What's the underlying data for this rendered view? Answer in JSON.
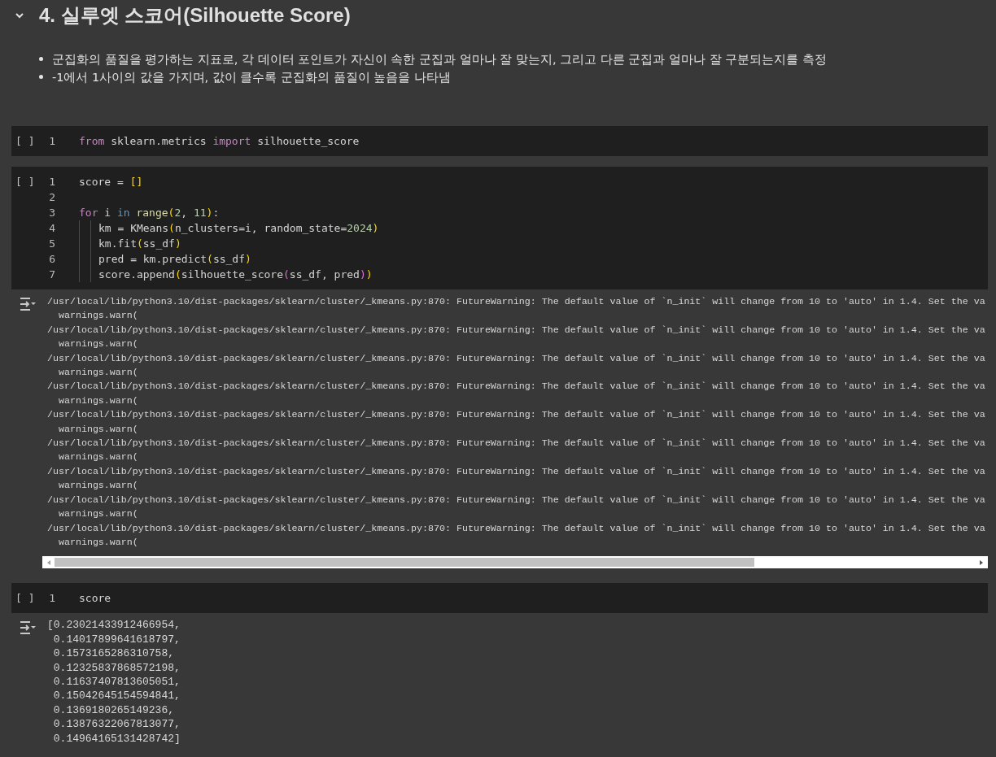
{
  "section": {
    "title": "4. 실루엣 스코어(Silhouette Score)",
    "expanded": true,
    "bullets": [
      "군집화의 품질을 평가하는 지표로, 각 데이터 포인트가 자신이 속한 군집과 얼마나 잘 맞는지, 그리고 다른 군집과 얼마나 잘 구분되는지를 측정",
      "-1에서 1사이의 값을 가지며, 값이 클수록 군집화의 품질이 높음을 나타냄"
    ]
  },
  "cells": [
    {
      "run_label": "[ ]",
      "lines": [
        {
          "number": "1",
          "tokens": [
            {
              "text": "from",
              "kind": "keyword"
            },
            {
              "text": " sklearn.metrics ",
              "kind": "plain"
            },
            {
              "text": "import",
              "kind": "keyword"
            },
            {
              "text": " silhouette_score",
              "kind": "plain"
            }
          ]
        }
      ]
    },
    {
      "run_label": "[ ]",
      "lines": [
        {
          "number": "1",
          "tokens": [
            {
              "text": "score = ",
              "kind": "plain"
            },
            {
              "text": "[]",
              "kind": "bracket"
            }
          ]
        },
        {
          "number": "2"
        },
        {
          "number": "3",
          "tokens": [
            {
              "text": "for",
              "kind": "keyword"
            },
            {
              "text": " i ",
              "kind": "plain"
            },
            {
              "text": "in",
              "kind": "operator"
            },
            {
              "text": " range",
              "kind": "function"
            },
            {
              "text": "(",
              "kind": "bracket"
            },
            {
              "text": "2",
              "kind": "number"
            },
            {
              "text": ", ",
              "kind": "plain"
            },
            {
              "text": "11",
              "kind": "number"
            },
            {
              "text": ")",
              "kind": "bracket"
            },
            {
              "text": ":",
              "kind": "plain"
            }
          ]
        },
        {
          "number": "4",
          "indented": true,
          "tokens": [
            {
              "text": "km = KMeans",
              "kind": "plain"
            },
            {
              "text": "(",
              "kind": "bracket"
            },
            {
              "text": "n_clusters=i, random_state=",
              "kind": "plain"
            },
            {
              "text": "2024",
              "kind": "number"
            },
            {
              "text": ")",
              "kind": "bracket"
            }
          ]
        },
        {
          "number": "5",
          "indented": true,
          "tokens": [
            {
              "text": "km.fit",
              "kind": "plain"
            },
            {
              "text": "(",
              "kind": "bracket"
            },
            {
              "text": "ss_df",
              "kind": "plain"
            },
            {
              "text": ")",
              "kind": "bracket"
            }
          ]
        },
        {
          "number": "6",
          "indented": true,
          "tokens": [
            {
              "text": "pred = km.predict",
              "kind": "plain"
            },
            {
              "text": "(",
              "kind": "bracket"
            },
            {
              "text": "ss_df",
              "kind": "plain"
            },
            {
              "text": ")",
              "kind": "bracket"
            }
          ]
        },
        {
          "number": "7",
          "indented": true,
          "tokens": [
            {
              "text": "score.append",
              "kind": "plain"
            },
            {
              "text": "(",
              "kind": "bracket"
            },
            {
              "text": "silhouette_score",
              "kind": "plain"
            },
            {
              "text": "(",
              "kind": "bracket2"
            },
            {
              "text": "ss_df, pred",
              "kind": "plain"
            },
            {
              "text": ")",
              "kind": "bracket2"
            },
            {
              "text": ")",
              "kind": "bracket"
            }
          ]
        }
      ],
      "output": {
        "scrollable": true,
        "lines": [
          "/usr/local/lib/python3.10/dist-packages/sklearn/cluster/_kmeans.py:870: FutureWarning: The default value of `n_init` will change from 10 to 'auto' in 1.4. Set the va",
          "  warnings.warn(",
          "/usr/local/lib/python3.10/dist-packages/sklearn/cluster/_kmeans.py:870: FutureWarning: The default value of `n_init` will change from 10 to 'auto' in 1.4. Set the va",
          "  warnings.warn(",
          "/usr/local/lib/python3.10/dist-packages/sklearn/cluster/_kmeans.py:870: FutureWarning: The default value of `n_init` will change from 10 to 'auto' in 1.4. Set the va",
          "  warnings.warn(",
          "/usr/local/lib/python3.10/dist-packages/sklearn/cluster/_kmeans.py:870: FutureWarning: The default value of `n_init` will change from 10 to 'auto' in 1.4. Set the va",
          "  warnings.warn(",
          "/usr/local/lib/python3.10/dist-packages/sklearn/cluster/_kmeans.py:870: FutureWarning: The default value of `n_init` will change from 10 to 'auto' in 1.4. Set the va",
          "  warnings.warn(",
          "/usr/local/lib/python3.10/dist-packages/sklearn/cluster/_kmeans.py:870: FutureWarning: The default value of `n_init` will change from 10 to 'auto' in 1.4. Set the va",
          "  warnings.warn(",
          "/usr/local/lib/python3.10/dist-packages/sklearn/cluster/_kmeans.py:870: FutureWarning: The default value of `n_init` will change from 10 to 'auto' in 1.4. Set the va",
          "  warnings.warn(",
          "/usr/local/lib/python3.10/dist-packages/sklearn/cluster/_kmeans.py:870: FutureWarning: The default value of `n_init` will change from 10 to 'auto' in 1.4. Set the va",
          "  warnings.warn(",
          "/usr/local/lib/python3.10/dist-packages/sklearn/cluster/_kmeans.py:870: FutureWarning: The default value of `n_init` will change from 10 to 'auto' in 1.4. Set the va",
          "  warnings.warn("
        ]
      }
    },
    {
      "run_label": "[ ]",
      "lines": [
        {
          "number": "1",
          "tokens": [
            {
              "text": "score",
              "kind": "plain"
            }
          ]
        }
      ],
      "output": {
        "scrollable": false,
        "lines": [
          "[0.23021433912466954,",
          " 0.14017899641618797,",
          " 0.1573165286310758,",
          " 0.12325837868572198,",
          " 0.11637407813605051,",
          " 0.15042645154594841,",
          " 0.1369180265149236,",
          " 0.13876322067813077,",
          " 0.14964165131428742]"
        ]
      }
    }
  ]
}
